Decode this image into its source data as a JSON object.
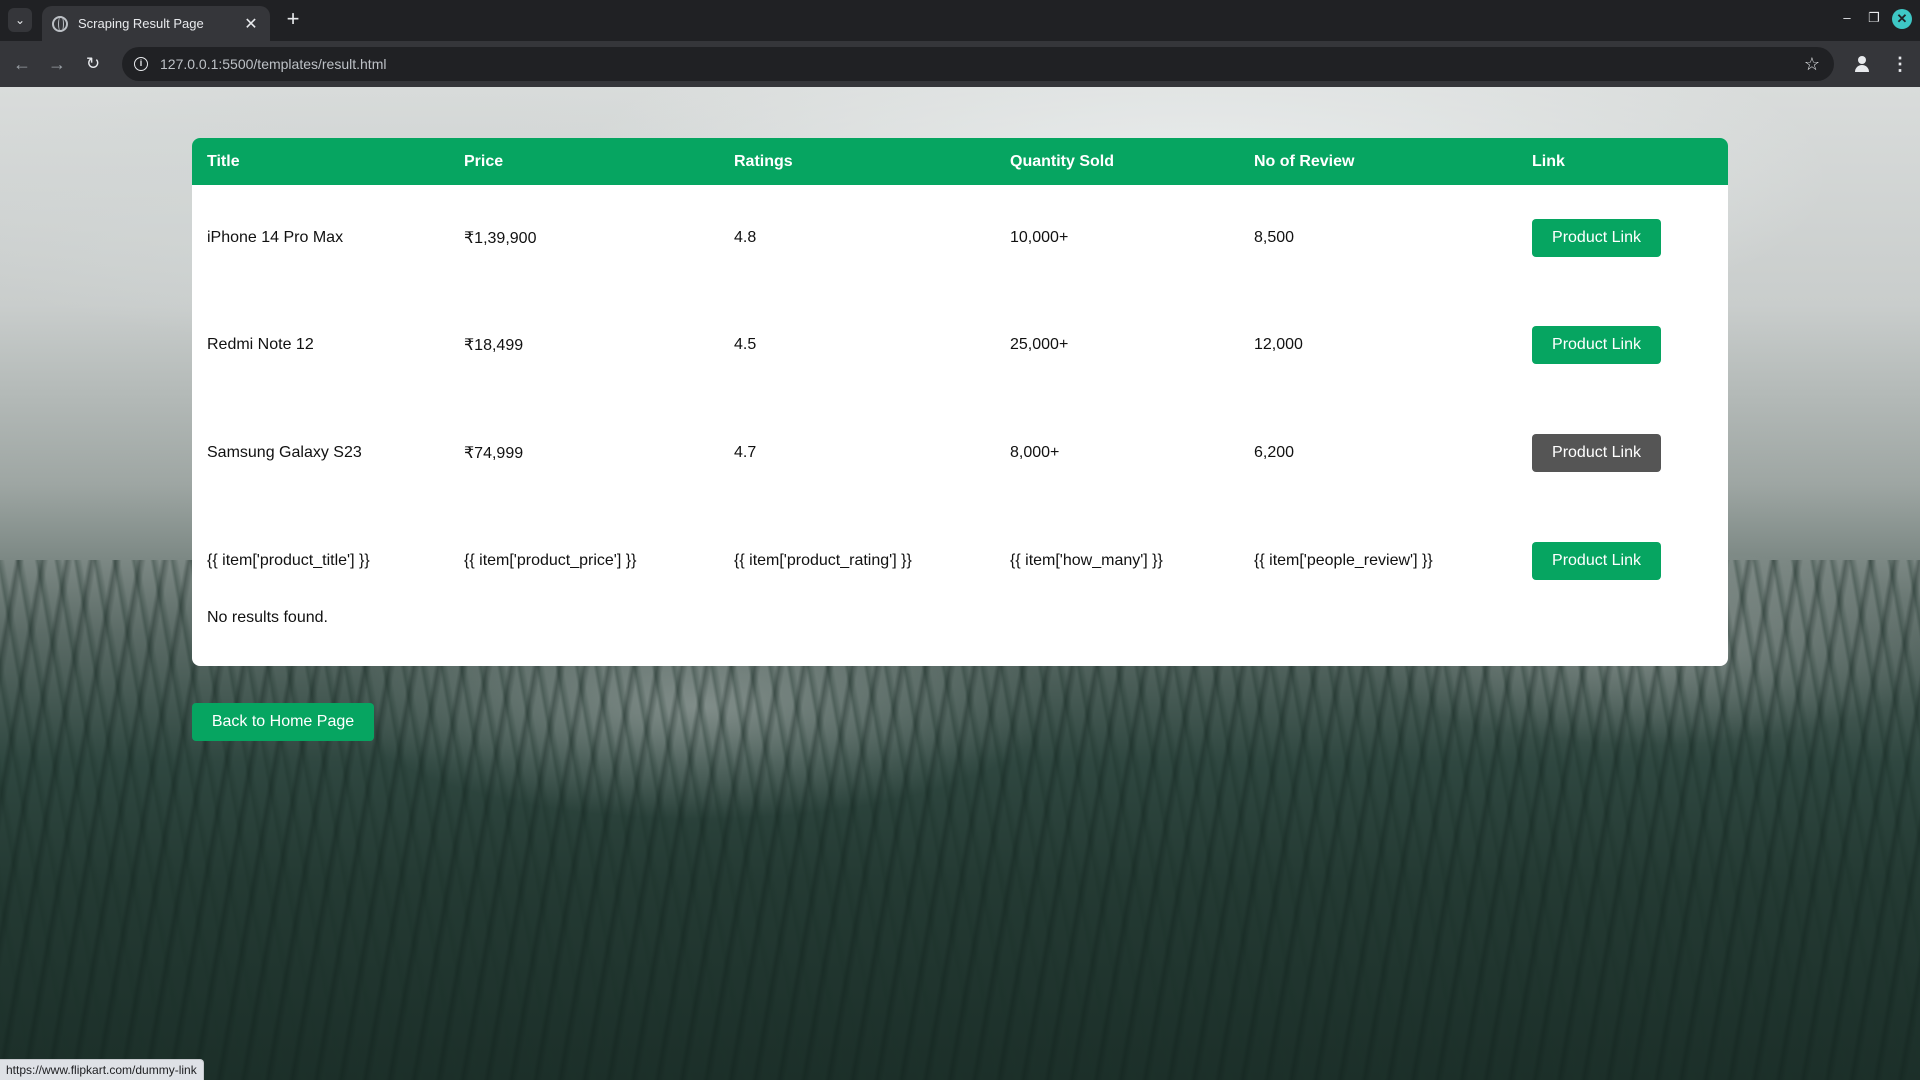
{
  "browser": {
    "tab_title": "Scraping Result Page",
    "url": "127.0.0.1:5500/templates/result.html",
    "status_url": "https://www.flipkart.com/dummy-link"
  },
  "table": {
    "headers": [
      "Title",
      "Price",
      "Ratings",
      "Quantity Sold",
      "No of Review",
      "Link"
    ],
    "rows": [
      {
        "title": "iPhone 14 Pro Max",
        "price": "₹1,39,900",
        "rating": "4.8",
        "sold": "10,000+",
        "reviews": "8,500",
        "link": "Product Link"
      },
      {
        "title": "Redmi Note 12",
        "price": "₹18,499",
        "rating": "4.5",
        "sold": "25,000+",
        "reviews": "12,000",
        "link": "Product Link"
      },
      {
        "title": "Samsung Galaxy S23",
        "price": "₹74,999",
        "rating": "4.7",
        "sold": "8,000+",
        "reviews": "6,200",
        "link": "Product Link"
      },
      {
        "title": "{{ item['product_title'] }}",
        "price": "{{ item['product_price'] }}",
        "rating": "{{ item['product_rating'] }}",
        "sold": "{{ item['how_many'] }}",
        "reviews": "{{ item['people_review'] }}",
        "link": "Product Link"
      }
    ],
    "empty_message": "No results found."
  },
  "back_button": "Back to Home Page",
  "colors": {
    "accent": "#06a561",
    "hover_button": "#555555"
  }
}
